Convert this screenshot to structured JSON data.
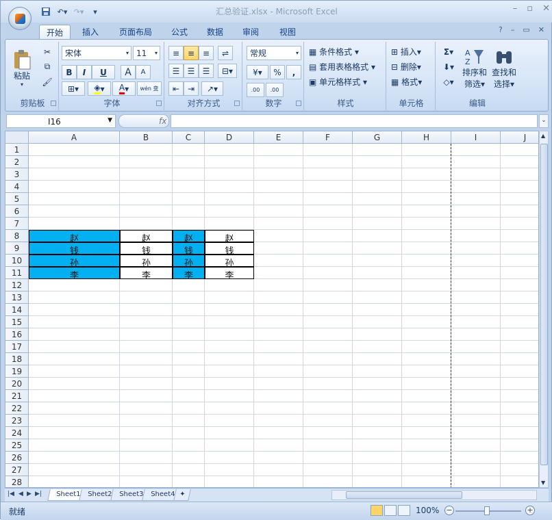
{
  "window": {
    "title": "汇总验证.xlsx - Microsoft Excel"
  },
  "tabs": [
    "开始",
    "插入",
    "页面布局",
    "公式",
    "数据",
    "审阅",
    "视图"
  ],
  "ribbon": {
    "clipboard": {
      "label": "剪贴板",
      "paste": "粘贴"
    },
    "font": {
      "label": "字体",
      "name": "宋体",
      "size": "11",
      "bold": "B",
      "italic": "I",
      "underline": "U",
      "grow": "A",
      "shrink": "A",
      "wen": "wén 变"
    },
    "alignment": {
      "label": "对齐方式"
    },
    "number": {
      "label": "数字",
      "format": "常规",
      "percent": "%",
      "comma": ",",
      "inc_decimal": ".00",
      "dec_decimal": ".00"
    },
    "styles": {
      "label": "样式",
      "conditional": "条件格式",
      "table": "套用表格格式",
      "cell": "单元格样式"
    },
    "cells": {
      "label": "单元格",
      "insert": "插入",
      "delete": "删除",
      "format": "格式"
    },
    "editing": {
      "label": "编辑",
      "sum": "Σ",
      "sort": "排序和",
      "sort2": "筛选",
      "find": "查找和",
      "find2": "选择"
    }
  },
  "formula_bar": {
    "name_box": "I16",
    "fx": "fx",
    "value": ""
  },
  "columns": [
    "A",
    "B",
    "C",
    "D",
    "E",
    "F",
    "G",
    "H",
    "I",
    "J"
  ],
  "rows": [
    "1",
    "2",
    "3",
    "4",
    "5",
    "6",
    "7",
    "8",
    "9",
    "10",
    "11",
    "12",
    "13",
    "14",
    "15",
    "16",
    "17",
    "18",
    "19",
    "20",
    "21",
    "22",
    "23",
    "24",
    "25",
    "26",
    "27",
    "28"
  ],
  "cells": {
    "A8": "赵",
    "B8": "赵",
    "C8": "赵",
    "D8": "赵",
    "A9": "钱",
    "B9": "钱",
    "C9": "钱",
    "D9": "钱",
    "A10": "孙",
    "B10": "孙",
    "C10": "孙",
    "D10": "孙",
    "A11": "李",
    "B11": "李",
    "C11": "李",
    "D11": "李"
  },
  "highlight_color": "#00b0f0",
  "sheets": [
    "Sheet1",
    "Sheet2",
    "Sheet3",
    "Sheet4"
  ],
  "active_sheet": "Sheet1",
  "status": {
    "ready": "就绪",
    "zoom": "100%"
  }
}
